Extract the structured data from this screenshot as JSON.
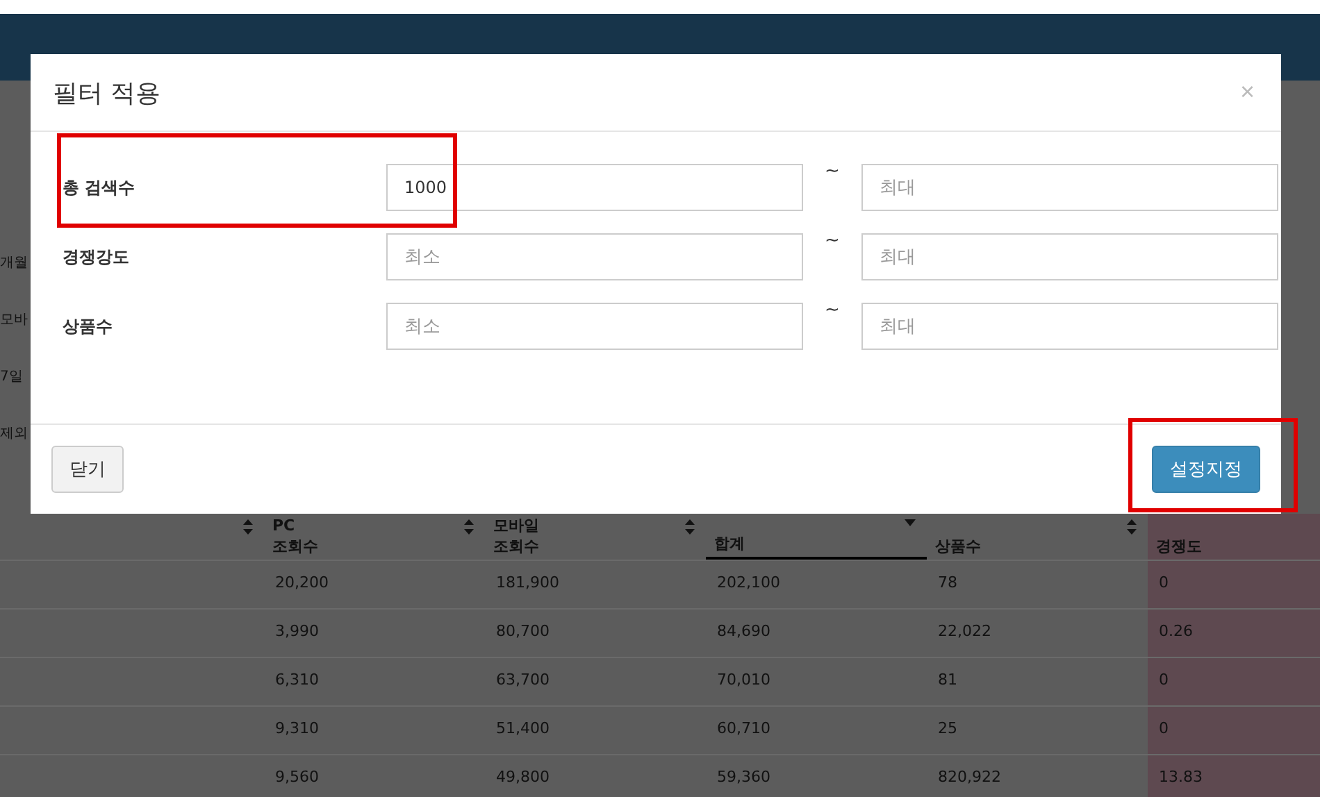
{
  "background": {
    "side_fragments": [
      "개월",
      "모바",
      "7일",
      "제외"
    ],
    "table": {
      "columns": [
        {
          "sortable": true,
          "sorted": false,
          "highlighted": false
        },
        {
          "label": [
            "PC",
            "조회수"
          ],
          "sortable": true,
          "sorted": false,
          "highlighted": false
        },
        {
          "label": [
            "모바일",
            "조회수"
          ],
          "sortable": true,
          "sorted": false,
          "highlighted": false
        },
        {
          "label": [
            "합계"
          ],
          "sortable": true,
          "sorted": true,
          "highlighted": false
        },
        {
          "label": [
            "상품수"
          ],
          "sortable": true,
          "sorted": false,
          "highlighted": false
        },
        {
          "label": [
            "경쟁도"
          ],
          "sortable": false,
          "sorted": false,
          "highlighted": true
        }
      ],
      "rows": [
        [
          "",
          "20,200",
          "181,900",
          "202,100",
          "78",
          "0"
        ],
        [
          "",
          "3,990",
          "80,700",
          "84,690",
          "22,022",
          "0.26"
        ],
        [
          "",
          "6,310",
          "63,700",
          "70,010",
          "81",
          "0"
        ],
        [
          "",
          "9,310",
          "51,400",
          "60,710",
          "25",
          "0"
        ],
        [
          "",
          "9,560",
          "49,800",
          "59,360",
          "820,922",
          "13.83"
        ]
      ]
    }
  },
  "modal": {
    "title": "필터 적용",
    "close": "×",
    "filters": [
      {
        "label": "총 검색수",
        "min": {
          "value": "1000"
        },
        "separator": "~",
        "max": {
          "placeholder": "최대"
        },
        "highlighted": true
      },
      {
        "label": "경쟁강도",
        "min": {
          "placeholder": "최소"
        },
        "separator": "~",
        "max": {
          "placeholder": "최대"
        },
        "highlighted": false
      },
      {
        "label": "상품수",
        "min": {
          "placeholder": "최소"
        },
        "separator": "~",
        "max": {
          "placeholder": "최대"
        },
        "highlighted": false
      }
    ],
    "buttons": [
      {
        "label": "닫기",
        "kind": "default",
        "highlighted": false
      },
      {
        "label": "설정지정",
        "kind": "primary",
        "highlighted": true
      }
    ]
  }
}
